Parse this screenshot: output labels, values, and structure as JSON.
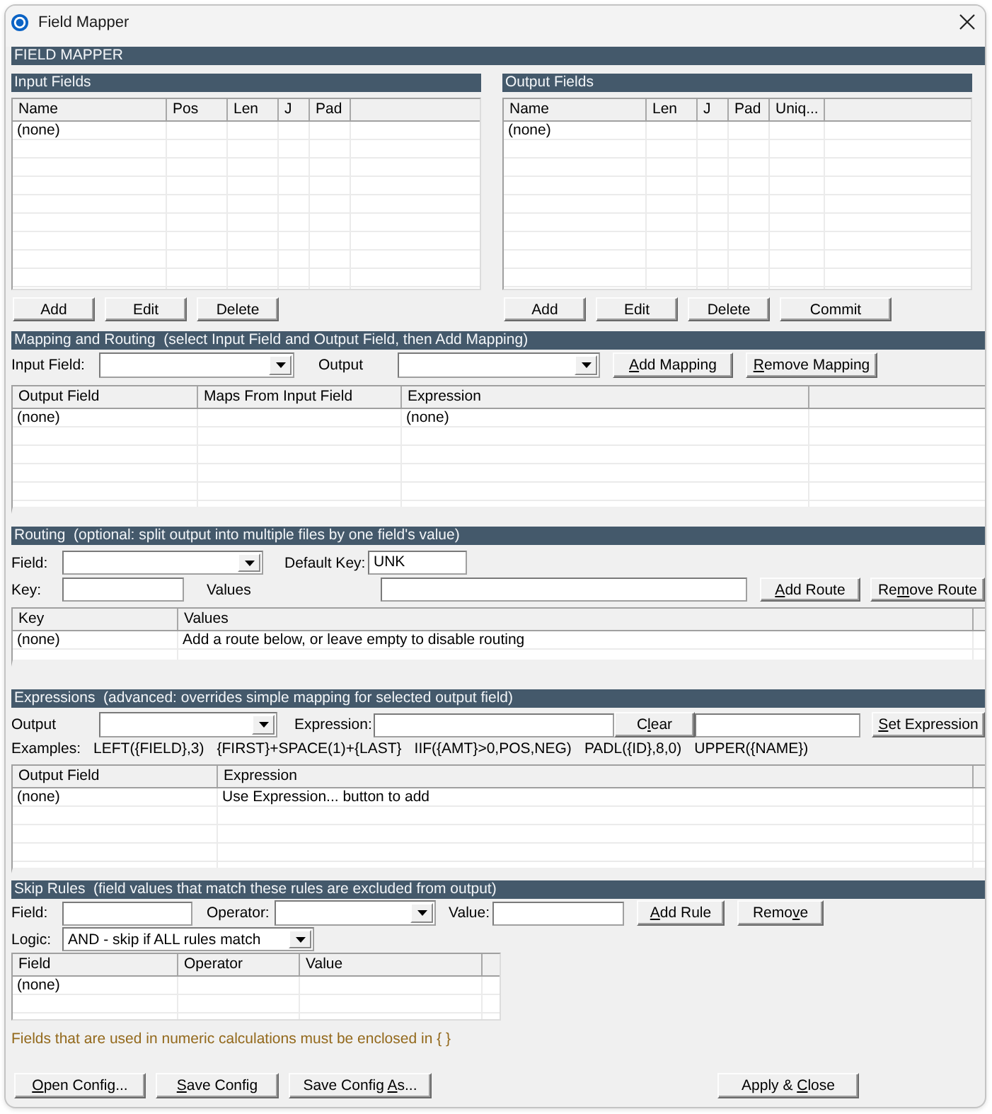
{
  "window": {
    "title": "Field Mapper"
  },
  "header": {
    "title": "FIELD MAPPER"
  },
  "input_fields": {
    "title": "Input Fields",
    "table": {
      "columns": [
        "Name",
        "Pos",
        "Len",
        "J",
        "Pad"
      ],
      "rows": [
        [
          "(none)"
        ]
      ]
    },
    "buttons": [
      {
        "label": "Add"
      },
      {
        "label": "Edit"
      },
      {
        "label": "Delete"
      }
    ]
  },
  "output_fields": {
    "title": "Output Fields",
    "table": {
      "columns": [
        "Name",
        "Len",
        "J",
        "Pad",
        "Uniq..."
      ],
      "rows": [
        [
          "(none)"
        ]
      ]
    },
    "buttons": [
      {
        "label": "Add"
      },
      {
        "label": "Edit"
      },
      {
        "label": "Delete"
      },
      {
        "label": "Commit"
      }
    ]
  },
  "mapping": {
    "title": "Mapping and Routing  (select Input Field and Output Field, then Add Mapping)",
    "control_rows": [
      [
        {
          "kind": "label",
          "text": "Input Field:"
        },
        {
          "kind": "dropdown"
        },
        {
          "kind": "label",
          "text": "Output"
        },
        {
          "kind": "dropdown"
        },
        {
          "kind": "button",
          "key": "A",
          "post": "dd Mapping"
        },
        {
          "kind": "button",
          "key": "R",
          "post": "emove Mapping"
        }
      ]
    ],
    "table": {
      "columns": [
        "Output Field",
        "Maps From Input Field",
        "Expression"
      ],
      "rows": [
        [
          "(none)",
          null,
          "(none)"
        ]
      ]
    }
  },
  "routing": {
    "title": "Routing  (optional: split output into multiple files by one field's value)",
    "control_rows": [
      [
        {
          "kind": "label",
          "text": "Field:"
        },
        {
          "kind": "dropdown"
        },
        {
          "kind": "label",
          "text": "Default Key:"
        },
        {
          "kind": "field",
          "value": "UNK"
        }
      ],
      [
        {
          "kind": "label",
          "text": "Key:"
        },
        {
          "kind": "field"
        },
        {
          "kind": "label",
          "text": "Values"
        },
        {
          "kind": "field"
        },
        {
          "kind": "button",
          "key": "A",
          "post": "dd Route"
        },
        {
          "kind": "button",
          "pre": "Re",
          "key": "m",
          "post": "ove Route"
        }
      ]
    ],
    "table": {
      "columns": [
        "Key",
        "Values"
      ],
      "rows": [
        [
          "(none)",
          "Add a route below, or leave empty to disable routing"
        ]
      ]
    }
  },
  "expressions": {
    "title": "Expressions  (advanced: overrides simple mapping for selected output field)",
    "control_rows": [
      [
        {
          "kind": "label",
          "text": "Output"
        },
        {
          "kind": "dropdown"
        },
        {
          "kind": "label",
          "text": "Expression:"
        },
        {
          "kind": "field"
        },
        {
          "kind": "button",
          "pre": "C",
          "key": "l",
          "post": "ear"
        },
        {
          "kind": "field"
        },
        {
          "kind": "button",
          "key": "S",
          "post": "et Expression"
        }
      ]
    ],
    "examples_label": "Examples:",
    "examples": [
      "LEFT({FIELD},3)",
      "{FIRST}+SPACE(1)+{LAST}",
      "IIF({AMT}>0,POS,NEG)",
      "PADL({ID},8,0)",
      "UPPER({NAME})"
    ],
    "table": {
      "columns": [
        "Output Field",
        "Expression"
      ],
      "rows": [
        [
          "(none)",
          "Use Expression... button to add"
        ]
      ]
    }
  },
  "skip_rules": {
    "title": "Skip Rules  (field values that match these rules are excluded from output)",
    "control_rows": [
      [
        {
          "kind": "label",
          "text": "Field:"
        },
        {
          "kind": "field"
        },
        {
          "kind": "label",
          "text": "Operator:"
        },
        {
          "kind": "dropdown"
        },
        {
          "kind": "label",
          "text": "Value:"
        },
        {
          "kind": "field"
        },
        {
          "kind": "button",
          "key": "A",
          "post": "dd Rule"
        },
        {
          "kind": "button",
          "pre": "Remo",
          "key": "v",
          "post": "e"
        }
      ],
      [
        {
          "kind": "label",
          "text": "Logic:"
        },
        {
          "kind": "dropdown",
          "value": "AND - skip if ALL rules match"
        }
      ]
    ],
    "table": {
      "columns": [
        "Field",
        "Operator",
        "Value"
      ],
      "rows": [
        [
          "(none)"
        ]
      ]
    }
  },
  "note": "Fields that are used in numeric calculations must be enclosed in { }",
  "footer_buttons": [
    {
      "key": "O",
      "post": "pen Config..."
    },
    {
      "key": "S",
      "post": "ave Config"
    },
    {
      "pre": "Save Config ",
      "key": "A",
      "post": "s..."
    },
    {
      "pre": "Apply & ",
      "key": "C",
      "post": "lose"
    }
  ]
}
